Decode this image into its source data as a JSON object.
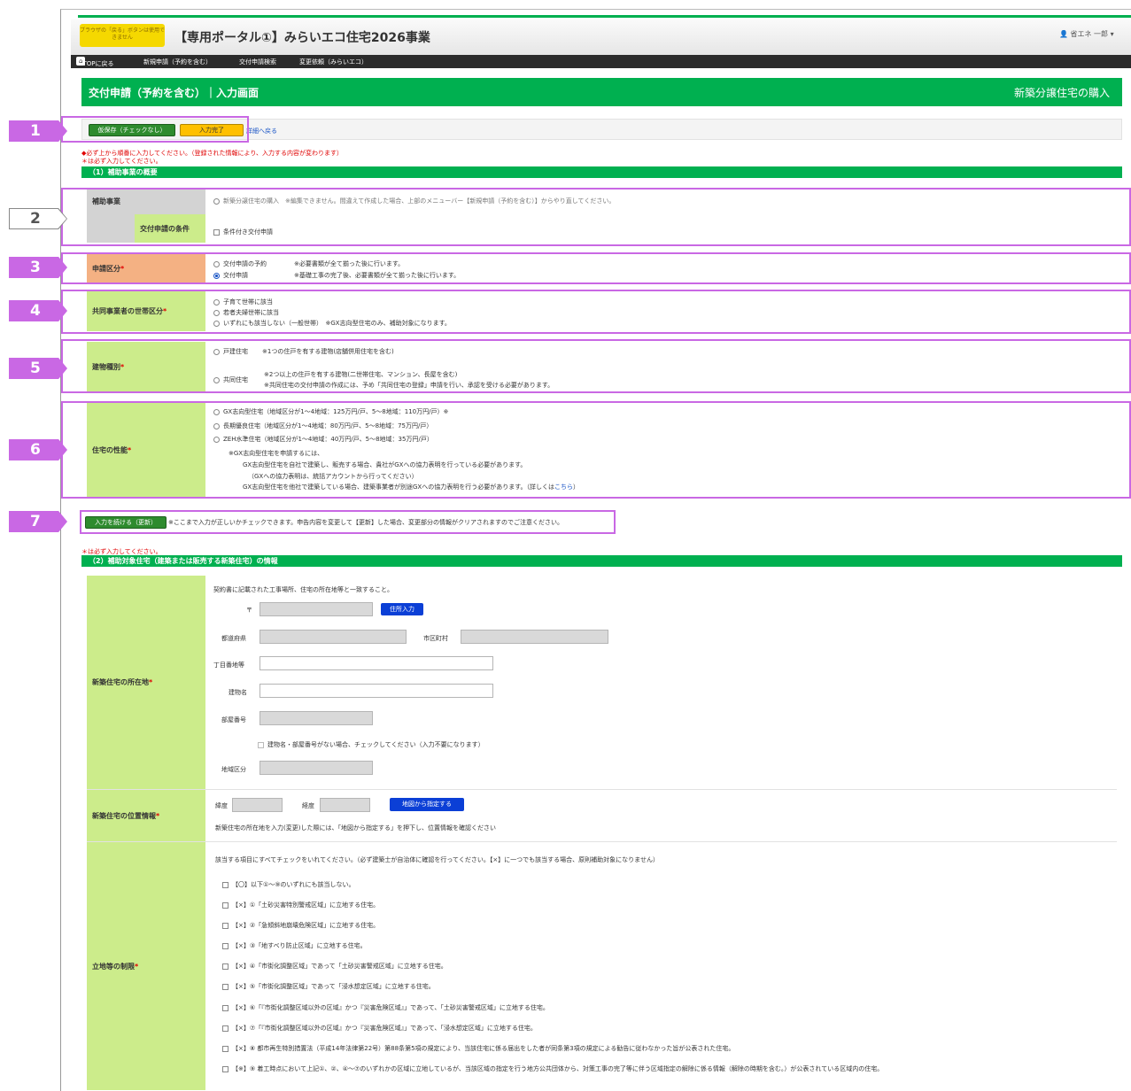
{
  "header": {
    "warning_text": "ブラウザの「戻る」ボタンは使用できません",
    "app_title": "【専用ポータル①】みらいエコ住宅2026事業",
    "user": "省エネ 一郎"
  },
  "nav": {
    "top": "TOPに戻る",
    "items": [
      "新規申請（予約を含む）",
      "交付申請検索",
      "変更依頼（みらいエコ）"
    ]
  },
  "page": {
    "title": "交付申請（予約を含む）｜入力画面",
    "type": "新築分譲住宅の購入"
  },
  "actions": {
    "save_temp": "仮保存（チェックなし）",
    "complete": "入力完了",
    "back": "詳細へ戻る"
  },
  "notes": {
    "order": "◆必ず上から順番に入力してください。（登録された情報により、入力する内容が変わります）",
    "required": "＊は必ず入力してください。",
    "required2": "＊は必ず入力してください。"
  },
  "section1": {
    "title": "（1）補助事業の概要",
    "project_label": "補助事業",
    "project_value": "新築分譲住宅の購入　※編集できません。間違えて作成した場合、上部のメニューバー【新規申請（予約を含む）】からやり直してください。",
    "condition_label": "交付申請の条件",
    "condition_option": "条件付き交付申請",
    "category_label": "申請区分",
    "category_options": [
      {
        "label": "交付申請の予約",
        "note": "※必要書類が全て揃った後に行います。"
      },
      {
        "label": "交付申請",
        "note": "※基礎工事の完了後、必要書類が全て揃った後に行います。"
      }
    ],
    "household_label": "共同事業者の世帯区分",
    "household_options": [
      "子育て世帯に該当",
      "若者夫婦世帯に該当",
      "いずれにも該当しない（一般世帯）　※GX志向型住宅のみ、補助対象になります。"
    ],
    "building_label": "建物種別",
    "building_detached": "戸建住宅",
    "building_detached_note": "※1つの住戸を有する建物(店舗併用住宅を含む)",
    "building_collective": "共同住宅",
    "building_collective_note1": "※2つ以上の住戸を有する建物(二世帯住宅、マンション、長屋を含む)",
    "building_collective_note2": "※共同住宅の交付申請の作成には、予め「共同住宅の登録」申請を行い、承認を受ける必要があります。",
    "perf_label": "住宅の性能",
    "perf_options": [
      "GX志向型住宅（地域区分が1〜4地域：125万円/戸、5〜8地域：110万円/戸）※",
      "長期優良住宅（地域区分が1〜4地域：80万円/戸、5〜8地域：75万円/戸）",
      "ZEH水準住宅（地域区分が1〜4地域：40万円/戸、5〜8地域：35万円/戸）"
    ],
    "perf_notes": [
      "※GX志向型住宅を申請するには、",
      "GX志向型住宅を自社で建築し、販売する場合、貴社がGXへの協力表明を行っている必要があります。",
      "（GXへの協力表明は、統括アカウントから行ってください）",
      "GX志向型住宅を他社で建築している場合、建築事業者が別途GXへの協力表明を行う必要があります。（詳しくは"
    ],
    "perf_link": "こちら",
    "perf_link_close": "）"
  },
  "update": {
    "button": "入力を続ける（更新）",
    "note": "※ここまで入力が正しいかチェックできます。申告内容を変更して【更新】した場合、変更部分の情報がクリアされますのでご注意ください。"
  },
  "section2": {
    "title": "（2）補助対象住宅（建築または販売する新築住宅）の情報",
    "location_label": "新築住宅の所在地",
    "location_note": "契約書に記載された工事場所、住宅の所在地等と一致すること。",
    "postal_mark": "〒",
    "address_button": "住所入力",
    "pref_label": "都道府県",
    "city_label": "市区町村",
    "street_label": "丁目番地等",
    "building_name_label": "建物名",
    "room_label": "部屋番号",
    "no_building_check": "建物名・部屋番号がない場合、チェックしてください（入力不要になります）",
    "region_label": "地域区分",
    "position_label": "新築住宅の位置情報",
    "lat_label": "緯度",
    "lng_label": "経度",
    "map_button": "地図から指定する",
    "position_note": "新築住宅の所在地を入力(変更)した際には、「地図から指定する」を押下し、位置情報を確認ください",
    "restrict_label": "立地等の制限",
    "restrict_note": "該当する項目にすべてチェックをいれてください。（必ず建築士が自治体に確認を行ってください。【×】に一つでも該当する場合、原則補助対象になりません）",
    "restrict_items": [
      "【〇】以下①〜⑨のいずれにも該当しない。",
      "【×】①「土砂災害特別警戒区域」に立地する住宅。",
      "【×】②「急傾斜地崩壊危険区域」に立地する住宅。",
      "【×】③「地すべり防止区域」に立地する住宅。",
      "【×】④「市街化調整区域」であって「土砂災害警戒区域」に立地する住宅。",
      "【×】⑤「市街化調整区域」であって「浸水想定区域」に立地する住宅。",
      "【×】⑥「『市街化調整区域以外の区域』かつ『災害危険区域』」であって、「土砂災害警戒区域」に立地する住宅。",
      "【×】⑦「『市街化調整区域以外の区域』かつ『災害危険区域』」であって、「浸水想定区域」に立地する住宅。",
      "【×】⑧ 都市再生特別措置法（平成14年法律第22号）第88条第5項の規定により、当該住宅に係る届出をした者が同条第3項の規定による勧告に従わなかった旨が公表された住宅。",
      "【※】⑨ 着工時点において上記①、②、④〜⑦のいずれかの区域に立地しているが、当該区域の指定を行う地方公共団体から、対策工事の完了等に伴う区域指定の解除に係る情報（解除の時期を含む。）が公表されている区域内の住宅。"
    ]
  },
  "callouts": [
    "1",
    "2",
    "3",
    "4",
    "5",
    "6",
    "7"
  ],
  "colors": {
    "accent": "#00b050",
    "label_bg": "#ccec8b",
    "highlight": "#c968e4",
    "required": "#e00000"
  }
}
